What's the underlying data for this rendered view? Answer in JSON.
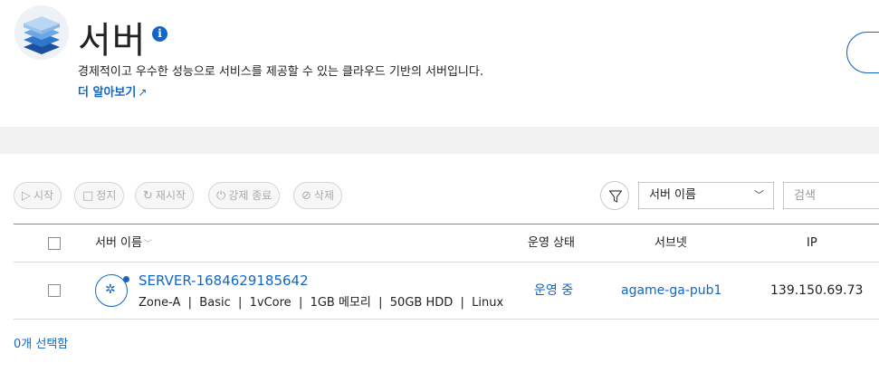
{
  "header": {
    "title": "서버",
    "description": "경제적이고 우수한 성능으로 서비스를 제공할 수 있는 클라우드 기반의 서버입니다.",
    "learn_more": "더 알아보기"
  },
  "toolbar": {
    "start": "시작",
    "stop": "정지",
    "restart": "재시작",
    "force_stop": "강제 종료",
    "delete": "삭제"
  },
  "filter": {
    "select_value": "서버 이름",
    "search_placeholder": "검색"
  },
  "table": {
    "columns": {
      "name": "서버 이름",
      "status": "운영 상태",
      "subnet": "서브넷",
      "ip": "IP"
    },
    "rows": [
      {
        "name": "SERVER-1684629185642",
        "spec": "Zone-A  |  Basic  |  1vCore  |  1GB 메모리  |  50GB HDD  |  Linux",
        "status": "운영 중",
        "subnet": "agame-ga-pub1",
        "ip": "139.150.69.73"
      }
    ]
  },
  "selection": {
    "count_text": "0개 선택함"
  },
  "colors": {
    "accent": "#1466c6",
    "band": "#f2f2f2"
  }
}
